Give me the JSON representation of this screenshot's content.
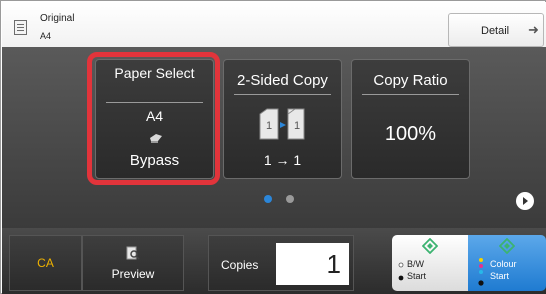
{
  "header": {
    "original_label": "Original",
    "original_size": "A4",
    "detail_label": "Detail"
  },
  "tiles": {
    "paper_select": {
      "title": "Paper Select",
      "size": "A4",
      "source": "Bypass"
    },
    "two_sided_copy": {
      "title": "2-Sided Copy",
      "value": "1 → 1"
    },
    "copy_ratio": {
      "title": "Copy Ratio",
      "value": "100%"
    }
  },
  "pager": {
    "pages": 2,
    "current": 1
  },
  "bottom": {
    "ca_label": "CA",
    "preview_label": "Preview",
    "copies_label": "Copies",
    "copies_value": "1",
    "bw_mode": "B/W",
    "bw_start": "Start",
    "color_mode": "Colour",
    "color_start": "Start"
  },
  "colors": {
    "highlight": "#e2343b",
    "ca_text": "#f0b300",
    "start_green": "#3cb371",
    "color_start_blue": "#1f7bd1",
    "page_dot_active": "#2b86d9"
  },
  "icons": [
    "original-doc-icon",
    "detail-arrow-icon",
    "bypass-tray-icon",
    "duplex-icon",
    "next-page-icon",
    "preview-icon",
    "start-diamond-icon"
  ]
}
